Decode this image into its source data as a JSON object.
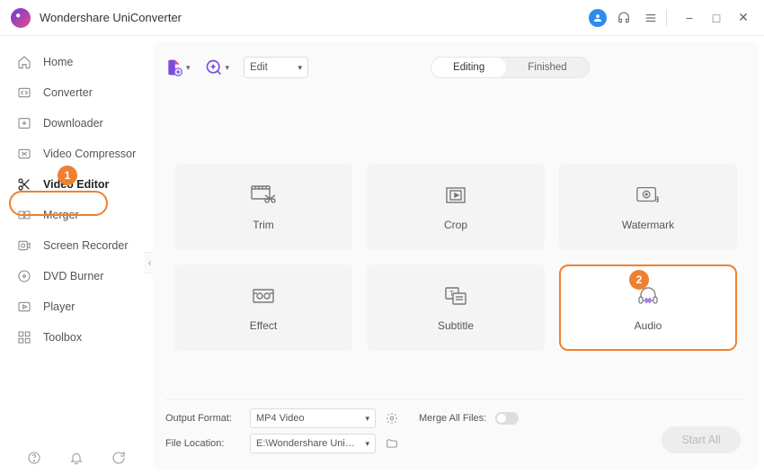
{
  "app": {
    "title": "Wondershare UniConverter"
  },
  "titlebar": {
    "user_icon": "user",
    "support_icon": "headset",
    "menu_icon": "menu",
    "min": "−",
    "max": "□",
    "close": "✕"
  },
  "sidebar": {
    "items": [
      {
        "icon": "home",
        "label": "Home"
      },
      {
        "icon": "convert",
        "label": "Converter"
      },
      {
        "icon": "download",
        "label": "Downloader"
      },
      {
        "icon": "compress",
        "label": "Video Compressor"
      },
      {
        "icon": "scissors",
        "label": "Video Editor",
        "active": true
      },
      {
        "icon": "merge",
        "label": "Merger"
      },
      {
        "icon": "record",
        "label": "Screen Recorder"
      },
      {
        "icon": "dvd",
        "label": "DVD Burner"
      },
      {
        "icon": "play",
        "label": "Player"
      },
      {
        "icon": "toolbox",
        "label": "Toolbox"
      }
    ],
    "footer_icons": [
      "help",
      "bell",
      "feedback"
    ]
  },
  "annotations": {
    "one": "1",
    "two": "2"
  },
  "toolbar": {
    "addfile_icon": "file-plus",
    "addurl_icon": "circle-plus",
    "edit_label": "Edit",
    "tabs": [
      {
        "label": "Editing",
        "active": true
      },
      {
        "label": "Finished",
        "active": false
      }
    ]
  },
  "grid": [
    {
      "icon": "trim",
      "label": "Trim"
    },
    {
      "icon": "crop",
      "label": "Crop"
    },
    {
      "icon": "watermark",
      "label": "Watermark"
    },
    {
      "icon": "effect",
      "label": "Effect"
    },
    {
      "icon": "subtitle",
      "label": "Subtitle"
    },
    {
      "icon": "audio",
      "label": "Audio",
      "highlighted": true
    }
  ],
  "footer": {
    "output_label": "Output Format:",
    "output_value": "MP4 Video",
    "location_label": "File Location:",
    "location_value": "E:\\Wondershare UniConverter",
    "merge_label": "Merge All Files:",
    "start_label": "Start All",
    "settings_icon": "gear",
    "folder_icon": "folder"
  }
}
